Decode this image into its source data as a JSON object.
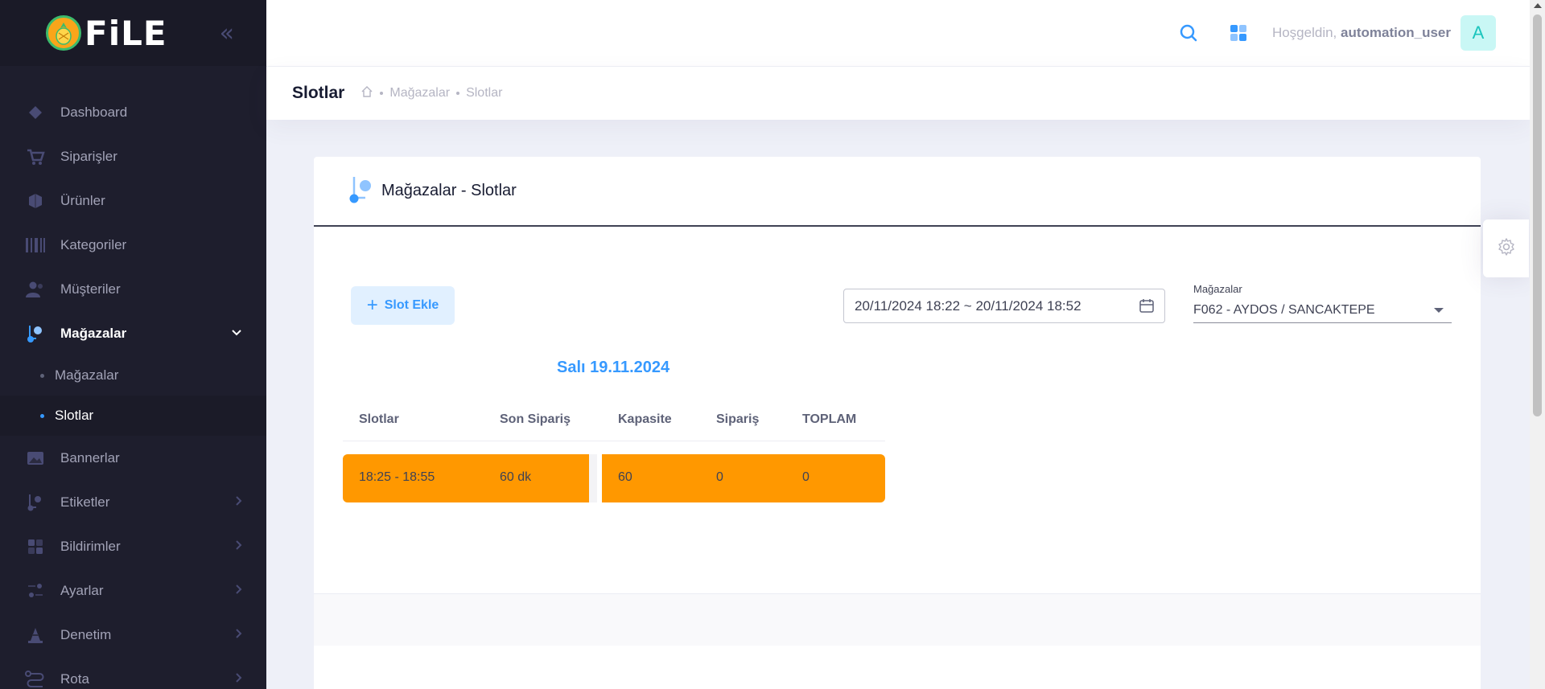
{
  "brand": {
    "name": "FiLE",
    "collapse_icon": "double-chevron-left-icon"
  },
  "sidebar": {
    "items": [
      {
        "label": "Dashboard",
        "icon": "diamond-icon"
      },
      {
        "label": "Siparişler",
        "icon": "cart-icon"
      },
      {
        "label": "Ürünler",
        "icon": "box-icon"
      },
      {
        "label": "Kategoriler",
        "icon": "barcode-icon"
      },
      {
        "label": "Müşteriler",
        "icon": "users-icon"
      },
      {
        "label": "Mağazalar",
        "icon": "store-icon",
        "active": true,
        "expanded": true
      },
      {
        "label": "Bannerlar",
        "icon": "image-icon"
      },
      {
        "label": "Etiketler",
        "icon": "tag-icon"
      },
      {
        "label": "Bildirimler",
        "icon": "grid-icon"
      },
      {
        "label": "Ayarlar",
        "icon": "sliders-icon"
      },
      {
        "label": "Denetim",
        "icon": "cone-icon"
      },
      {
        "label": "Rota",
        "icon": "route-icon"
      }
    ],
    "sub_items": [
      {
        "label": "Mağazalar"
      },
      {
        "label": "Slotlar",
        "active": true
      }
    ]
  },
  "topbar": {
    "greeting_prefix": "Hoşgeldin,",
    "username": "automation_user",
    "avatar_letter": "A"
  },
  "subheader": {
    "title": "Slotlar",
    "breadcrumb": [
      "Mağazalar",
      "Slotlar"
    ]
  },
  "card": {
    "title": "Mağazalar - Slotlar",
    "add_button": "Slot Ekle",
    "date_range": "20/11/2024 18:22 ~ 20/11/2024 18:52",
    "store_label": "Mağazalar",
    "store_value": "F062 - AYDOS / SANCAKTEPE",
    "day_title": "Salı 19.11.2024",
    "columns": [
      "Slotlar",
      "Son Sipariş",
      "Kapasite",
      "Sipariş",
      "TOPLAM"
    ],
    "rows": [
      {
        "slot": "18:25 - 18:55",
        "last_order": "60 dk",
        "capacity": "60",
        "orders": "0",
        "total": "0",
        "color": "#ff9800"
      }
    ]
  },
  "colors": {
    "primary": "#3699ff",
    "slot_bg": "#ff9800",
    "sidebar_bg": "#1e1e2d"
  }
}
